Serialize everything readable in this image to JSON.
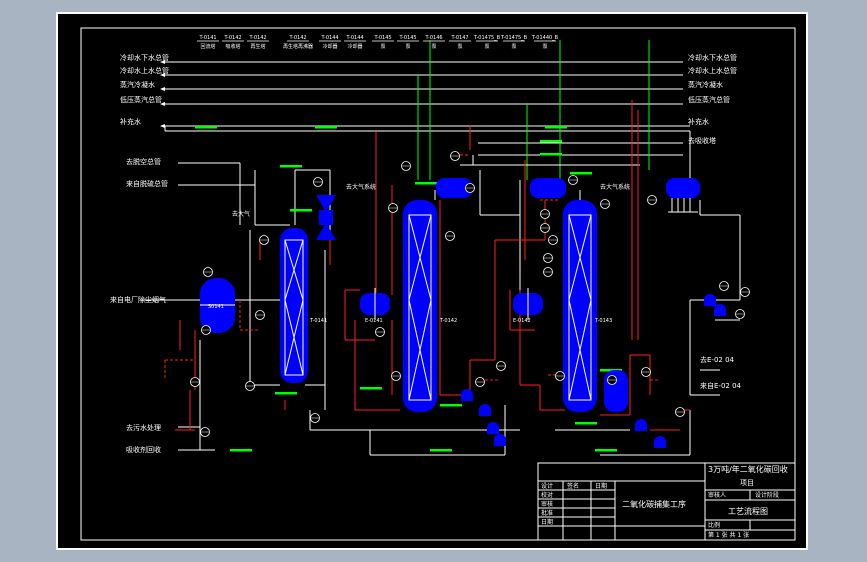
{
  "header_tags": [
    {
      "tag": "T-0141",
      "desc": "回流塔"
    },
    {
      "tag": "T-0142",
      "desc": "吸收塔"
    },
    {
      "tag": "T-0142",
      "desc": "再生塔"
    },
    {
      "tag": "T-0142",
      "desc": "再生塔再沸器"
    },
    {
      "tag": "T-0144",
      "desc": "冷却器"
    },
    {
      "tag": "T-0144",
      "desc": "冷却器"
    },
    {
      "tag": "T-0145",
      "desc": "泵"
    },
    {
      "tag": "T-0145",
      "desc": "泵"
    },
    {
      "tag": "T-0146",
      "desc": "泵"
    },
    {
      "tag": "T-0147",
      "desc": "泵"
    },
    {
      "tag": "T-01475_B",
      "desc": "泵"
    },
    {
      "tag": "T-01475_B",
      "desc": "泵"
    },
    {
      "tag": "T-01440_B",
      "desc": "泵"
    }
  ],
  "left_utilities": [
    "冷却水下水总管",
    "冷却水上水总管",
    "蒸汽冷凝水",
    "低压蒸汽总管",
    "补充水"
  ],
  "right_utilities": [
    "冷却水下水总管",
    "冷却水上水总管",
    "蒸汽冷凝水",
    "低压蒸汽总管",
    "补充水",
    "去吸收塔"
  ],
  "left_streams": [
    "去脱空总管",
    "来自脱硫总管",
    "来自电厂除尘烟气",
    "去污水处理",
    "吸收剂回收"
  ],
  "right_streams": [
    "去E-02 04",
    "来自E-02 04"
  ],
  "equipment": [
    {
      "id": "V-0141",
      "label": "S0141"
    },
    {
      "id": "T-0141",
      "label": "T-0141"
    },
    {
      "id": "T-0142",
      "label": "T-0142"
    },
    {
      "id": "E-0141",
      "label": "E-0141"
    },
    {
      "id": "T-0143",
      "label": "T-0143"
    },
    {
      "id": "E-0142",
      "label": "E-0142"
    }
  ],
  "annotations": [
    "去大气",
    "去大气系统",
    "去大气系统"
  ],
  "title_block": {
    "project": "3万吨/年二氧化碳回收",
    "subproject": "项目",
    "drawing_title": "工艺流程图",
    "section_title": "二氧化碳捕集工序",
    "rows": [
      "设计",
      "校对",
      "审核",
      "批准",
      "日期"
    ],
    "cols": [
      "签名",
      "日期"
    ],
    "checker": "审核人",
    "design_stage": "设计阶段",
    "scale": "比例",
    "sheet": "第 1 张 共 1 张"
  },
  "colors": {
    "background": "#000000",
    "equipment": "#0000ff",
    "process_line": "#ff0000",
    "utility_line": "#ffffff",
    "tag_text": "#00ff00",
    "frame_outer": "#a9b4c2"
  }
}
